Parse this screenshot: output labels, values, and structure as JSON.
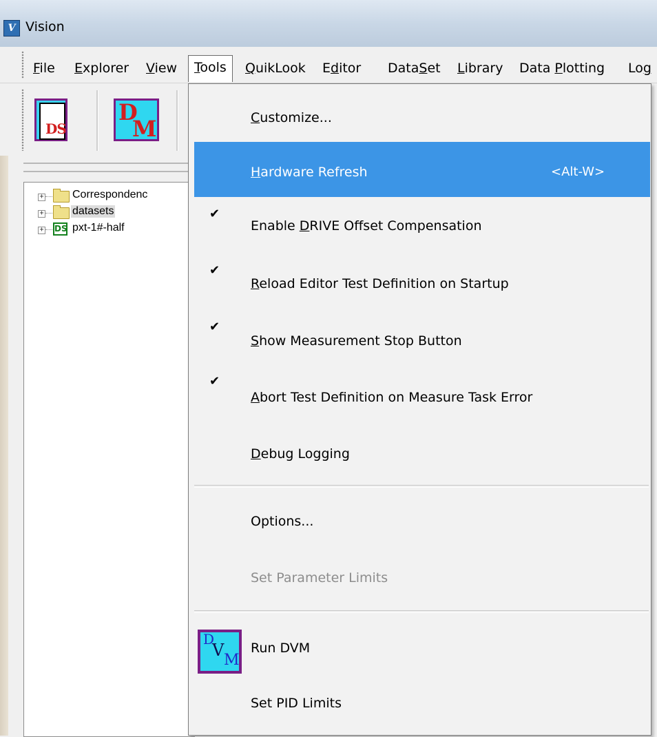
{
  "window": {
    "title": "Vision"
  },
  "menubar": {
    "items": [
      {
        "label": "File",
        "mnemonic": "F"
      },
      {
        "label": "Explorer",
        "mnemonic": "E"
      },
      {
        "label": "View",
        "mnemonic": "V"
      },
      {
        "label": "Tools",
        "mnemonic": "T"
      },
      {
        "label": "QuikLook",
        "mnemonic": "Q"
      },
      {
        "label": "Editor",
        "mnemonic": "d"
      },
      {
        "label": "DataSet",
        "mnemonic": "S"
      },
      {
        "label": "Library",
        "mnemonic": "L"
      },
      {
        "label": "Data Plotting",
        "mnemonic": "P"
      },
      {
        "label": "Log",
        "mnemonic": "g"
      }
    ],
    "open_menu": "Tools"
  },
  "toolbar": {
    "buttons": [
      {
        "icon": "dataset-icon",
        "letters": "DS"
      },
      {
        "icon": "data-manager-icon",
        "letters": "DM"
      }
    ]
  },
  "tree": {
    "nodes": [
      {
        "label": "Correspondenc",
        "icon": "folder-icon",
        "expander": "+"
      },
      {
        "label": "datasets",
        "icon": "folder-icon",
        "expander": "+",
        "selected": true
      },
      {
        "label": "pxt-1#-half",
        "icon": "dataset-node-icon",
        "icon_text": "DS",
        "expander": "+"
      }
    ]
  },
  "tools_menu": {
    "items": [
      {
        "label": "Customize...",
        "mnemonic": "C"
      },
      {
        "label": "Hardware Refresh",
        "mnemonic": "H",
        "shortcut": "<Alt-W>",
        "highlighted": true
      },
      {
        "label": "Enable DRIVE Offset Compensation",
        "checked": true
      },
      {
        "label": "Reload Editor Test Definition on Startup",
        "checked": true
      },
      {
        "label": "Show Measurement Stop Button",
        "checked": true
      },
      {
        "label": "Abort Test Definition on Measure Task Error",
        "checked": true
      },
      {
        "label": "Debug Logging"
      },
      {
        "label": "Options..."
      },
      {
        "label": "Set Parameter Limits",
        "disabled": true
      },
      {
        "label": "Run DVM",
        "icon": "dvm-icon"
      },
      {
        "label": "Set PID Limits"
      }
    ],
    "check_glyph": "✔"
  },
  "colors": {
    "highlight": "#3c95e6",
    "disabled_text": "#8d8d8d",
    "icon_cyan": "#2fd7f0",
    "icon_border_purple": "#7a1f86",
    "ds_green": "#12801c"
  }
}
